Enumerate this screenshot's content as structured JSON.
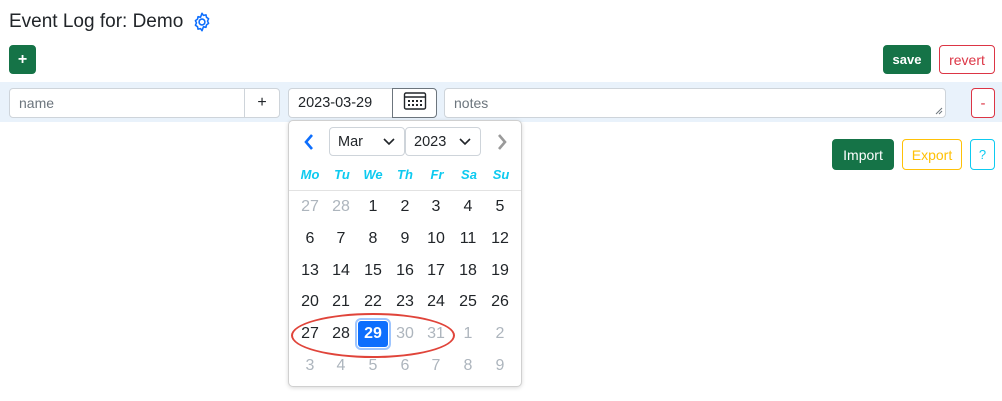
{
  "header": {
    "title": "Event Log for: Demo",
    "settings_icon": "gear-icon"
  },
  "toolbar": {
    "add_label": "+",
    "save_label": "save",
    "revert_label": "revert"
  },
  "entry_row": {
    "name_placeholder": "name",
    "name_add_label": "+",
    "date_value": "2023-03-29",
    "calendar_icon": "calendar-icon",
    "notes_placeholder": "notes",
    "remove_label": "-"
  },
  "actions": {
    "import_label": "Import",
    "export_label": "Export",
    "help_label": "?"
  },
  "datepicker": {
    "prev_icon": "chevron-left-icon",
    "next_icon": "chevron-right-icon",
    "month": "Mar",
    "year": "2023",
    "weekdays": [
      "Mo",
      "Tu",
      "We",
      "Th",
      "Fr",
      "Sa",
      "Su"
    ],
    "weeks": [
      [
        "27",
        "28",
        "1",
        "2",
        "3",
        "4",
        "5"
      ],
      [
        "6",
        "7",
        "8",
        "9",
        "10",
        "11",
        "12"
      ],
      [
        "13",
        "14",
        "15",
        "16",
        "17",
        "18",
        "19"
      ],
      [
        "20",
        "21",
        "22",
        "23",
        "24",
        "25",
        "26"
      ],
      [
        "27",
        "28",
        "29",
        "30",
        "31",
        "1",
        "2"
      ],
      [
        "3",
        "4",
        "5",
        "6",
        "7",
        "8",
        "9"
      ]
    ],
    "muted_flags": [
      [
        1,
        1,
        0,
        0,
        0,
        0,
        0
      ],
      [
        0,
        0,
        0,
        0,
        0,
        0,
        0
      ],
      [
        0,
        0,
        0,
        0,
        0,
        0,
        0
      ],
      [
        0,
        0,
        0,
        0,
        0,
        0,
        0
      ],
      [
        0,
        0,
        0,
        1,
        1,
        1,
        1
      ],
      [
        1,
        1,
        1,
        1,
        1,
        1,
        1
      ]
    ],
    "selected_day": "29",
    "accent_color": "#0d6efd",
    "weekday_color": "#0dcaf0"
  },
  "colors": {
    "primary_green": "#157347",
    "danger": "#dc3545",
    "warning": "#ffc107",
    "info": "#0dcaf0",
    "row_band": "#e9f2fb",
    "annotation_red": "#e0443a"
  }
}
